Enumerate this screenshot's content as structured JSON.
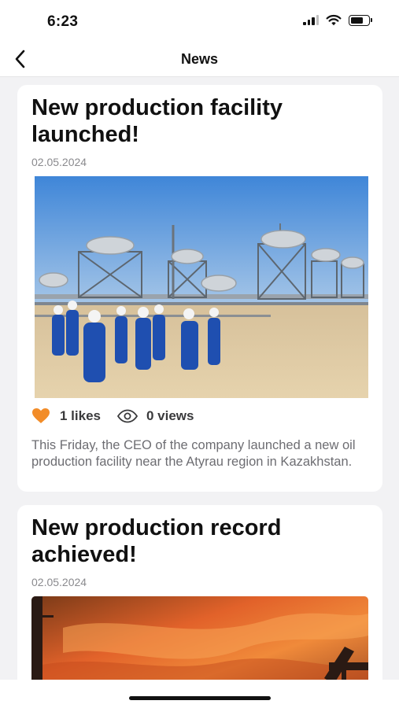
{
  "status_bar": {
    "time": "6:23",
    "icons": [
      "cellular-signal-icon",
      "wifi-icon",
      "battery-icon"
    ]
  },
  "nav": {
    "title": "News",
    "back_icon": "chevron-left-icon"
  },
  "news": [
    {
      "title": "New production facility launched!",
      "date": "02.05.2024",
      "image": "photo of workers in blue coveralls at an oil facility",
      "likes_label": "1 likes",
      "views_label": "0 views",
      "body": "This Friday, the CEO of the company launched a new oil production facility near the Atyrau region in Kazakhstan.",
      "liked": true
    },
    {
      "title": "New production record achieved!",
      "date": "02.05.2024",
      "image": "photo of oil pump jacks against an orange sunset sky"
    }
  ],
  "colors": {
    "accent": "#f28c28",
    "background": "#f2f2f4",
    "card": "#ffffff",
    "muted_text": "#8a8a8e"
  }
}
